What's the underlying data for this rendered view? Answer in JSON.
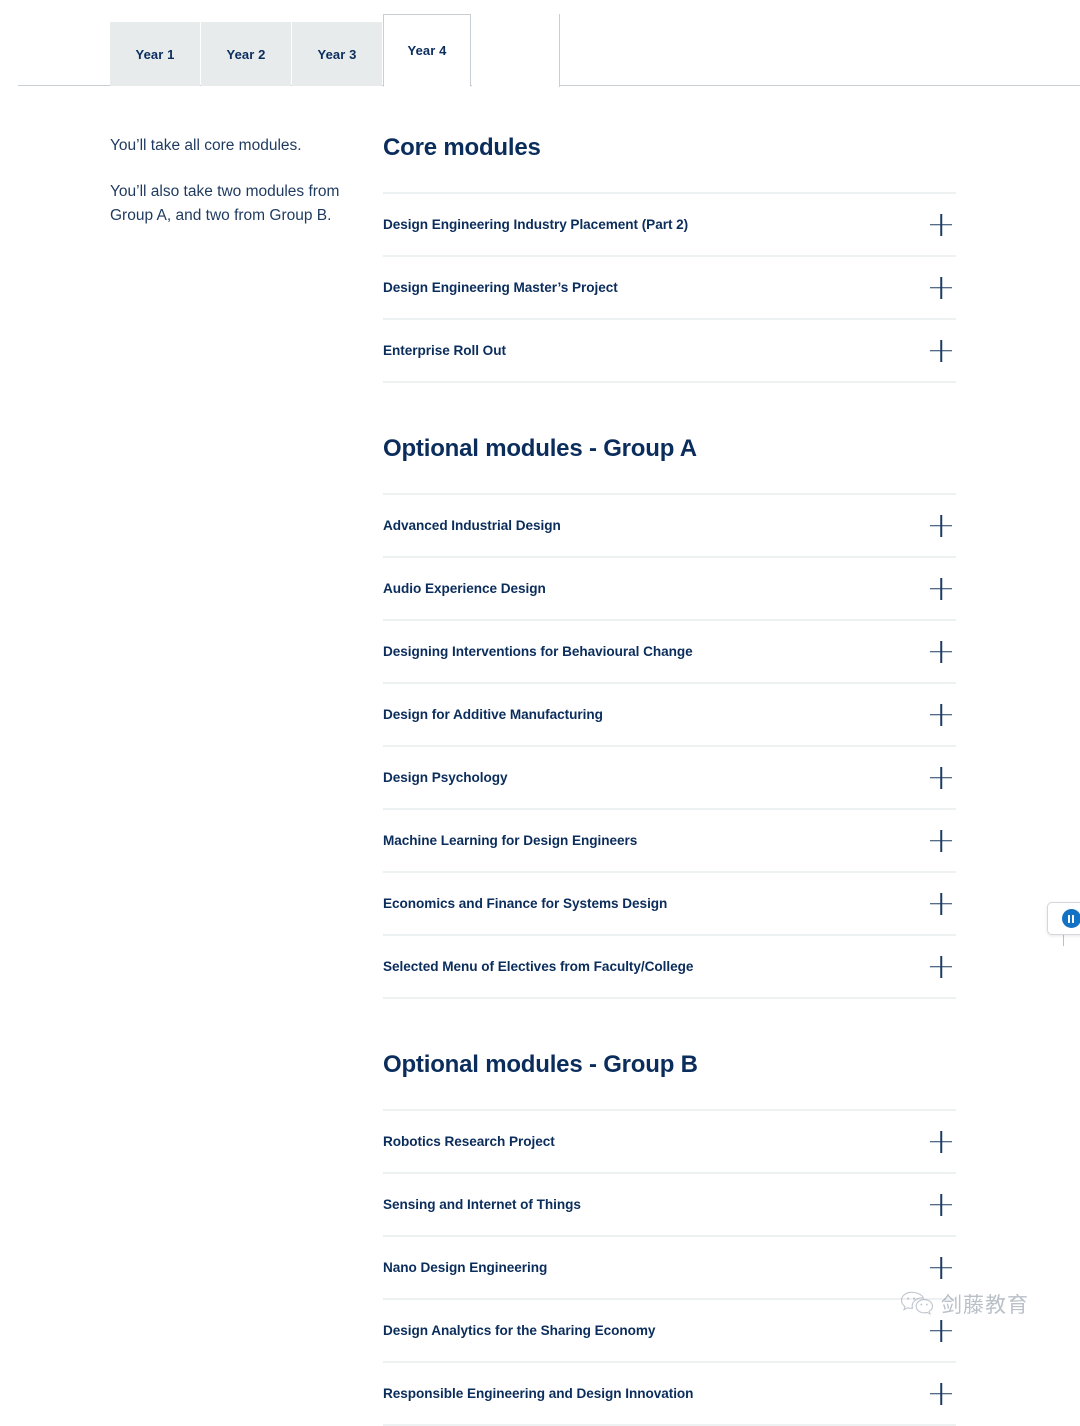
{
  "tabs": {
    "items": [
      {
        "label": "Year 1",
        "active": false
      },
      {
        "label": "Year 2",
        "active": false
      },
      {
        "label": "Year 3",
        "active": false
      },
      {
        "label": "Year 4",
        "active": true
      }
    ]
  },
  "left": {
    "paragraph_1": "You’ll take all core modules.",
    "paragraph_2": "You’ll also take two modules from Group A, and two from Group B."
  },
  "groups": [
    {
      "title": "Core modules",
      "modules": [
        "Design Engineering Industry Placement (Part 2)",
        "Design Engineering Master’s Project",
        "Enterprise Roll Out"
      ]
    },
    {
      "title": "Optional modules - Group A",
      "modules": [
        "Advanced Industrial Design",
        "Audio Experience Design",
        "Designing Interventions for Behavioural Change",
        "Design for Additive Manufacturing",
        "Design Psychology",
        "Machine Learning for Design Engineers",
        "Economics and Finance for Systems Design",
        "Selected Menu of Electives from Faculty/College"
      ]
    },
    {
      "title": "Optional modules - Group B",
      "modules": [
        "Robotics Research Project",
        "Sensing and Internet of Things",
        "Nano Design Engineering",
        "Design Analytics for the Sharing Economy",
        "Responsible Engineering and Design Innovation"
      ]
    }
  ],
  "icons": {
    "expand": "plus-icon",
    "media_control": "pause-icon",
    "watermark_logo": "wechat-icon"
  },
  "media_widget": {
    "state": "pause"
  },
  "watermark": {
    "text": "剑藤教育"
  },
  "colors": {
    "brand_navy": "#0b2d5c",
    "accent_blue": "#1372c4",
    "tab_inactive_bg": "#e7ebec",
    "divider": "#eef1f2",
    "border": "#c9ced3"
  }
}
